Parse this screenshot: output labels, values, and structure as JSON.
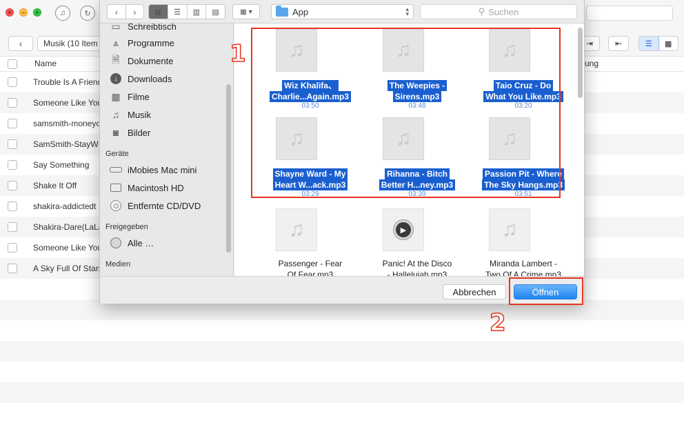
{
  "background_app": {
    "toolbar": {
      "breadcrumb": "Musik (10 Item"
    },
    "columns": {
      "name": "Name",
      "right_partial": "ung"
    },
    "rows": [
      "Trouble Is A Friend",
      "Someone Like You",
      "samsmith-moneyo",
      "SamSmith-StayW",
      "Say Something",
      "Shake It Off",
      "shakira-addictedt",
      "Shakira-Dare(LaLa",
      "Someone Like You",
      "A Sky Full Of Stars"
    ]
  },
  "dialog": {
    "location": "App",
    "search_placeholder": "Suchen",
    "sidebar": {
      "partial_top": "Schreibtisch",
      "favorites": [
        {
          "label": "Programme",
          "icon": "apps-icon"
        },
        {
          "label": "Dokumente",
          "icon": "document-icon"
        },
        {
          "label": "Downloads",
          "icon": "download-icon"
        },
        {
          "label": "Filme",
          "icon": "film-icon"
        },
        {
          "label": "Musik",
          "icon": "music-icon"
        },
        {
          "label": "Bilder",
          "icon": "camera-icon"
        }
      ],
      "devices_heading": "Geräte",
      "devices": [
        {
          "label": "iMobies Mac mini",
          "icon": "mac-mini-icon"
        },
        {
          "label": "Macintosh HD",
          "icon": "hard-drive-icon"
        },
        {
          "label": "Entfernte CD/DVD",
          "icon": "disc-icon"
        }
      ],
      "shared_heading": "Freigegeben",
      "shared": [
        {
          "label": "Alle …",
          "icon": "network-icon"
        }
      ],
      "media_heading": "Medien"
    },
    "files": [
      {
        "line1": "Wiz Khalifa、",
        "line2": "Charlie...Again.mp3",
        "duration": "03:50",
        "selected": true
      },
      {
        "line1": "The Weepies -",
        "line2": "Sirens.mp3",
        "duration": "03:48",
        "selected": true
      },
      {
        "line1": "Taio Cruz - Do",
        "line2": "What You Like.mp3",
        "duration": "03:20",
        "selected": true
      },
      {
        "line1": "Shayne Ward - My",
        "line2": "Heart W...ack.mp3",
        "duration": "03:29",
        "selected": true
      },
      {
        "line1": "Rihanna - Bitch",
        "line2": "Better H...ney.mp3",
        "duration": "03:39",
        "selected": true
      },
      {
        "line1": "Passion Pit - Where",
        "line2": "The Sky Hangs.mp3",
        "duration": "03:51",
        "selected": true
      },
      {
        "line1": "Passenger - Fear",
        "line2": "Of Fear.mp3",
        "selected": false
      },
      {
        "line1": "Panic! At the Disco",
        "line2": "- Hallelujah.mp3",
        "selected": false
      },
      {
        "line1": "Miranda Lambert -",
        "line2": "Two Of A Crime.mp3",
        "selected": false
      }
    ],
    "buttons": {
      "cancel": "Abbrechen",
      "open": "Öffnen"
    }
  },
  "annotations": {
    "step1": "1",
    "step2": "2",
    "color": "#e8331e"
  }
}
